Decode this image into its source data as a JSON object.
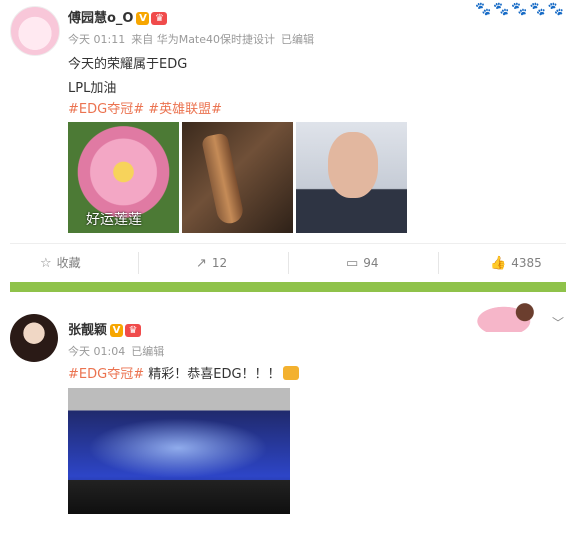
{
  "post1": {
    "username": "傅园慧o_O",
    "badge_v": "V",
    "badge_crown": "♛",
    "time": "今天 01:11",
    "source": "来自 华为Mate40保时捷设计",
    "edited": "已编辑",
    "line1": "今天的荣耀属于EDG",
    "line2": "LPL加油",
    "topic1": "#EDG夺冠#",
    "topic2": "#英雄联盟#",
    "thumb1_caption": "好运莲莲",
    "actions": {
      "favorite": "收藏",
      "repost": "12",
      "comment": "94",
      "like": "4385"
    }
  },
  "post2": {
    "username": "张靓颖",
    "badge_v": "V",
    "badge_crown": "♛",
    "time": "今天 01:04",
    "edited": "已编辑",
    "topic": "#EDG夺冠#",
    "text": " 精彩！恭喜EDG！！！"
  },
  "icons": {
    "top_right": "🐾🐾🐾🐾🐾",
    "chevron": "﹀",
    "favorite": "☆",
    "repost": "↗",
    "comment": "▭",
    "like": "👍"
  },
  "colors": {
    "topic": "#eb7350",
    "divider": "#8fc24a",
    "verified": "#f7a600"
  }
}
